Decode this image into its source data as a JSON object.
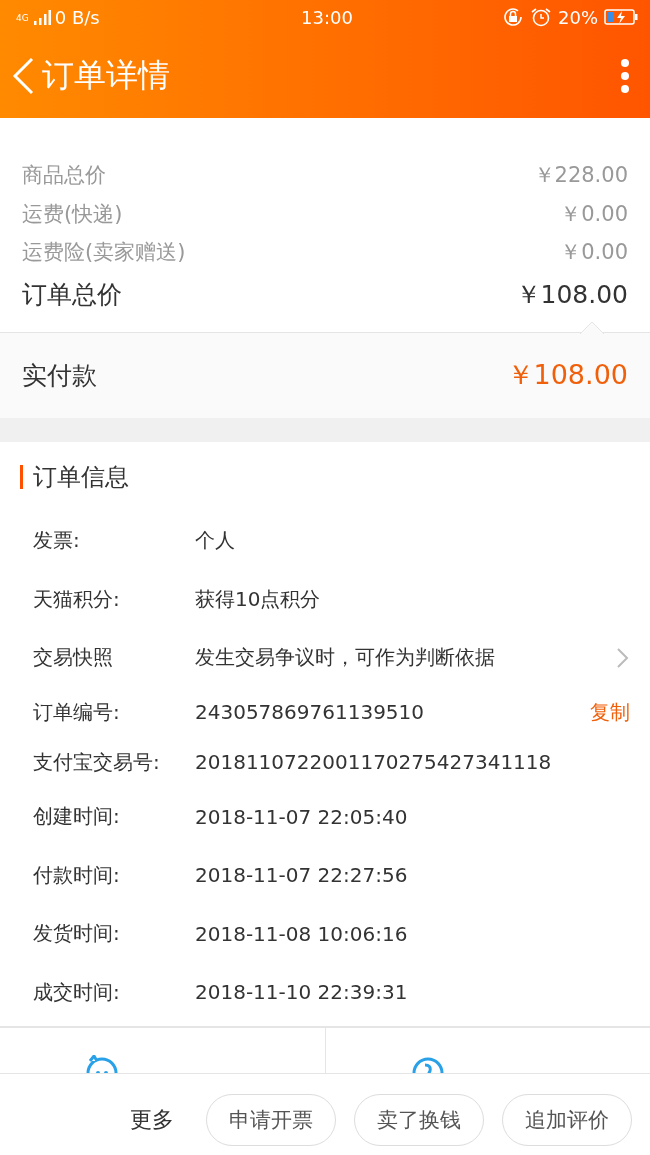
{
  "status_bar": {
    "network": "4G",
    "speed": "0 B/s",
    "time": "13:00",
    "battery": "20%"
  },
  "header": {
    "title": "订单详情"
  },
  "price_rows": [
    {
      "label": "商品总价",
      "value": "￥228.00",
      "kind": "minor"
    },
    {
      "label": "运费(快递)",
      "value": "￥0.00",
      "kind": "minor"
    },
    {
      "label": "运费险(卖家赠送)",
      "value": "￥0.00",
      "kind": "minor"
    },
    {
      "label": "订单总价",
      "value": "￥108.00",
      "kind": "total"
    }
  ],
  "paid": {
    "label": "实付款",
    "value": "￥108.00"
  },
  "order_info": {
    "title": "订单信息",
    "rows": [
      {
        "label": "发票:",
        "value": "个人",
        "kind": "plain"
      },
      {
        "label": "天猫积分:",
        "value": "获得10点积分",
        "kind": "plain"
      },
      {
        "label": "交易快照",
        "value": "发生交易争议时，可作为判断依据",
        "kind": "link"
      },
      {
        "label": "订单编号:",
        "value": "243057869761139510",
        "kind": "copy",
        "action": "复制"
      },
      {
        "label": "支付宝交易号:",
        "value": "2018110722001170275427341118",
        "kind": "plain"
      },
      {
        "label": "创建时间:",
        "value": "2018-11-07 22:05:40",
        "kind": "plain"
      },
      {
        "label": "付款时间:",
        "value": "2018-11-07 22:27:56",
        "kind": "plain"
      },
      {
        "label": "发货时间:",
        "value": "2018-11-08 10:06:16",
        "kind": "plain"
      },
      {
        "label": "成交时间:",
        "value": "2018-11-10 22:39:31",
        "kind": "plain"
      }
    ]
  },
  "contact": [
    {
      "kind": "chat"
    },
    {
      "kind": "phone"
    }
  ],
  "bottom_bar": {
    "more": "更多",
    "buttons": [
      "申请开票",
      "卖了换钱",
      "追加评价"
    ]
  }
}
